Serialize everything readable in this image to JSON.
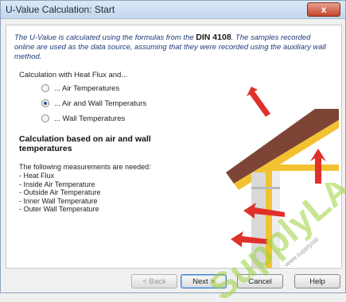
{
  "window": {
    "title": "U-Value Calculation: Start",
    "close_glyph": "x"
  },
  "intro": {
    "text_1": "The U-Value is calculated using the formulas from the ",
    "standard": "DIN 4108",
    "text_2": ". The samples recorded online are used as the data source, assuming that they were recorded using the auxiliary wall method."
  },
  "options": {
    "title": "Calculation with Heat Flux and...",
    "items": [
      {
        "label": "... Air Temperatures",
        "checked": false
      },
      {
        "label": "... Air and Wall Temperaturs",
        "checked": true
      },
      {
        "label": "... Wall Temperatures",
        "checked": false
      }
    ]
  },
  "details": {
    "heading": "Calculation based on air and wall temperatures",
    "needed_intro": "The following measurements are needed:",
    "needed": [
      "- Heat Flux",
      "- Inside Air Temperature",
      "- Outside Air Temperature",
      "- Inner Wall Temperature",
      "- Outer Wall Temperature"
    ]
  },
  "buttons": {
    "back": "< Back",
    "next": "Next >",
    "cancel": "Cancel",
    "help": "Help"
  },
  "watermark": {
    "brand": "SupplyLAB",
    "url": "www.supplylab"
  },
  "colors": {
    "roof": "#8a4a3a",
    "insulation": "#f2c230",
    "arrow": "#e0302a",
    "watermark_green": "#9ad13a"
  }
}
